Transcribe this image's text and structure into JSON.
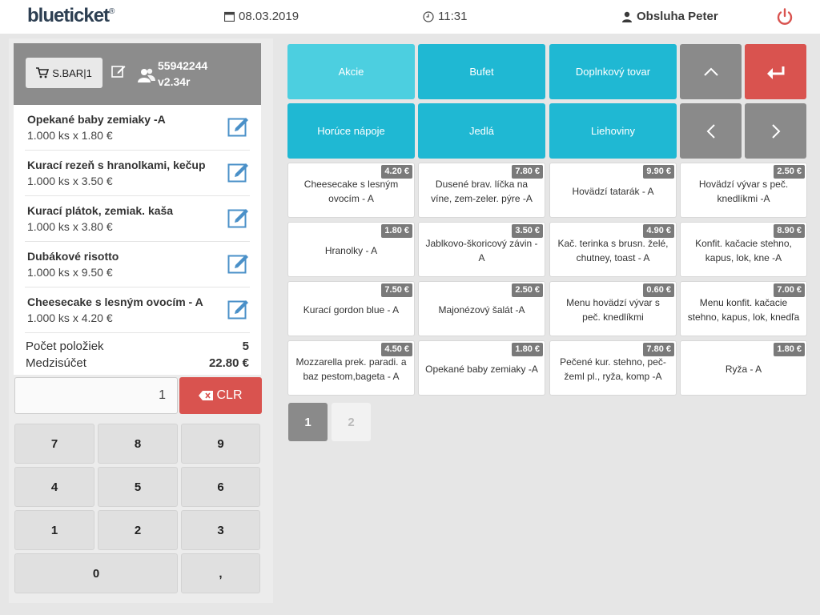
{
  "header": {
    "logo": "blueticket",
    "logo_mark": "®",
    "date": "08.03.2019",
    "time": "11:31",
    "user": "Obsluha Peter"
  },
  "cart": {
    "bar_label": "S.BAR|1",
    "terminal_id": "55942244",
    "version": "v2.34r",
    "items": [
      {
        "name": "Opekané baby zemiaky -A",
        "qty": "1.000 ks x 1.80 €"
      },
      {
        "name": "Kurací rezeň s hranolkami, kečup",
        "qty": "1.000 ks x 3.50 €"
      },
      {
        "name": "Kurací plátok, zemiak. kaša",
        "qty": "1.000 ks x 3.80 €"
      },
      {
        "name": "Dubákové risotto",
        "qty": "1.000 ks x 9.50 €"
      },
      {
        "name": "Cheesecake s lesným ovocím - A",
        "qty": "1.000 ks x 4.20 €"
      }
    ],
    "count_label": "Počet položiek",
    "count_value": "5",
    "subtotal_label": "Medzisúčet",
    "subtotal_value": "22.80 €"
  },
  "keypad": {
    "input_value": "1",
    "clr_label": "CLR",
    "keys": [
      "7",
      "8",
      "9",
      "4",
      "5",
      "6",
      "1",
      "2",
      "3",
      "0",
      ","
    ]
  },
  "categories": [
    {
      "label": "Akcie",
      "color": "#4ccfe0"
    },
    {
      "label": "Bufet",
      "color": "#1fb8d3"
    },
    {
      "label": "Doplnkový tovar",
      "color": "#1fb8d3"
    },
    {
      "label": "Horúce nápoje",
      "color": "#1fb8d3"
    },
    {
      "label": "Jedlá",
      "color": "#1fb8d3"
    },
    {
      "label": "Liehoviny",
      "color": "#1fb8d3"
    }
  ],
  "products": [
    {
      "name": "Cheesecake s lesným ovocím - A",
      "price": "4.20 €"
    },
    {
      "name": "Dusené brav. líčka na víne, zem-zeler. pýre -A",
      "price": "7.80 €"
    },
    {
      "name": "Hovädzí tatarák - A",
      "price": "9.90 €"
    },
    {
      "name": "Hovädzí vývar s peč. knedlíkmi -A",
      "price": "2.50 €"
    },
    {
      "name": "Hranolky - A",
      "price": "1.80 €"
    },
    {
      "name": "Jablkovo-škoricový závin - A",
      "price": "3.50 €"
    },
    {
      "name": "Kač. terinka s brusn. želé, chutney, toast - A",
      "price": "4.90 €"
    },
    {
      "name": "Konfit. kačacie stehno, kapus, lok, kne -A",
      "price": "8.90 €"
    },
    {
      "name": "Kurací gordon blue - A",
      "price": "7.50 €"
    },
    {
      "name": "Majonézový šalát -A",
      "price": "2.50 €"
    },
    {
      "name": "Menu hovädzí vývar s peč. knedlíkmi",
      "price": "0.60 €"
    },
    {
      "name": "Menu konfit. kačacie stehno, kapus, lok, knedľa",
      "price": "7.00 €"
    },
    {
      "name": "Mozzarella prek. paradi. a baz pestom,bageta - A",
      "price": "4.50 €"
    },
    {
      "name": "Opekané baby zemiaky -A",
      "price": "1.80 €"
    },
    {
      "name": "Pečené kur. stehno, peč-žeml pl., ryža, komp -A",
      "price": "7.80 €"
    },
    {
      "name": "Ryža - A",
      "price": "1.80 €"
    }
  ],
  "pages": [
    "1",
    "2"
  ],
  "colors": {
    "category_active": "#4ccfe0",
    "category": "#1fb8d3",
    "nav": "#8a8a8a",
    "back": "#d9534f",
    "clr": "#d9534f",
    "price_badge": "#7a7a7a",
    "edit_icon": "#4a90c8"
  },
  "icons": {
    "calendar": "calendar-icon",
    "clock": "clock-icon",
    "user": "user-icon",
    "power": "power-icon",
    "cart": "cart-icon",
    "edit": "edit-icon",
    "users": "users-icon",
    "backspace": "backspace-icon",
    "up": "chevron-up-icon",
    "back": "return-icon",
    "left": "chevron-left-icon",
    "right": "chevron-right-icon"
  }
}
